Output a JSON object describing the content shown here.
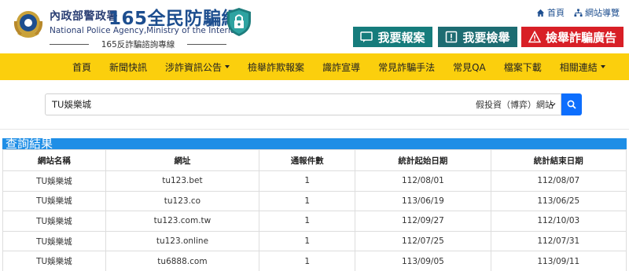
{
  "header": {
    "agency_zh": "內政部警政署",
    "site_name": "165全民防騙網",
    "agency_en": "National Police Agency,Ministry of the Interior",
    "tagline": "165反詐騙諮詢專線"
  },
  "toplinks": {
    "home": "首頁",
    "sitemap": "網站導覽"
  },
  "actions": {
    "report": "我要報案",
    "tip": "我要檢舉",
    "fraud_ad": "檢舉詐騙廣告"
  },
  "nav": {
    "items": [
      {
        "label": "首頁",
        "dropdown": false
      },
      {
        "label": "新聞快訊",
        "dropdown": false
      },
      {
        "label": "涉詐資訊公告",
        "dropdown": true
      },
      {
        "label": "檢舉詐欺報案",
        "dropdown": false
      },
      {
        "label": "識詐宣導",
        "dropdown": false
      },
      {
        "label": "常見詐騙手法",
        "dropdown": false
      },
      {
        "label": "常見QA",
        "dropdown": false
      },
      {
        "label": "檔案下載",
        "dropdown": false
      },
      {
        "label": "相關連結",
        "dropdown": true
      }
    ]
  },
  "search": {
    "value": "TU娛樂城",
    "category": "假投資（博弈）網站"
  },
  "results": {
    "title": "查詢結果",
    "columns": [
      "網站名稱",
      "網址",
      "通報件數",
      "統計起始日期",
      "統計結束日期"
    ],
    "rows": [
      [
        "TU娛樂城",
        "tu123.bet",
        "1",
        "112/08/01",
        "112/08/07"
      ],
      [
        "TU娛樂城",
        "tu123.co",
        "1",
        "113/06/19",
        "113/06/25"
      ],
      [
        "TU娛樂城",
        "tu123.com.tw",
        "1",
        "112/09/27",
        "112/10/03"
      ],
      [
        "TU娛樂城",
        "tu123.online",
        "1",
        "112/07/25",
        "112/07/31"
      ],
      [
        "TU娛樂城",
        "tu6888.com",
        "1",
        "113/09/05",
        "113/09/11"
      ]
    ]
  },
  "colors": {
    "nav_bg": "#fbcf0d",
    "report_btn": "#167c7c",
    "tip_btn": "#1d6c72",
    "ad_btn": "#d81f26",
    "results_header": "#1e8ee6",
    "search_btn": "#0d6efd"
  },
  "icons": {
    "emblem": "police-emblem-icon",
    "shield": "lock-shield-icon",
    "home": "home-icon",
    "sitemap": "sitemap-icon",
    "report": "chat-icon",
    "tip": "exclamation-icon",
    "fraud_ad": "warning-icon",
    "search": "search-icon"
  }
}
